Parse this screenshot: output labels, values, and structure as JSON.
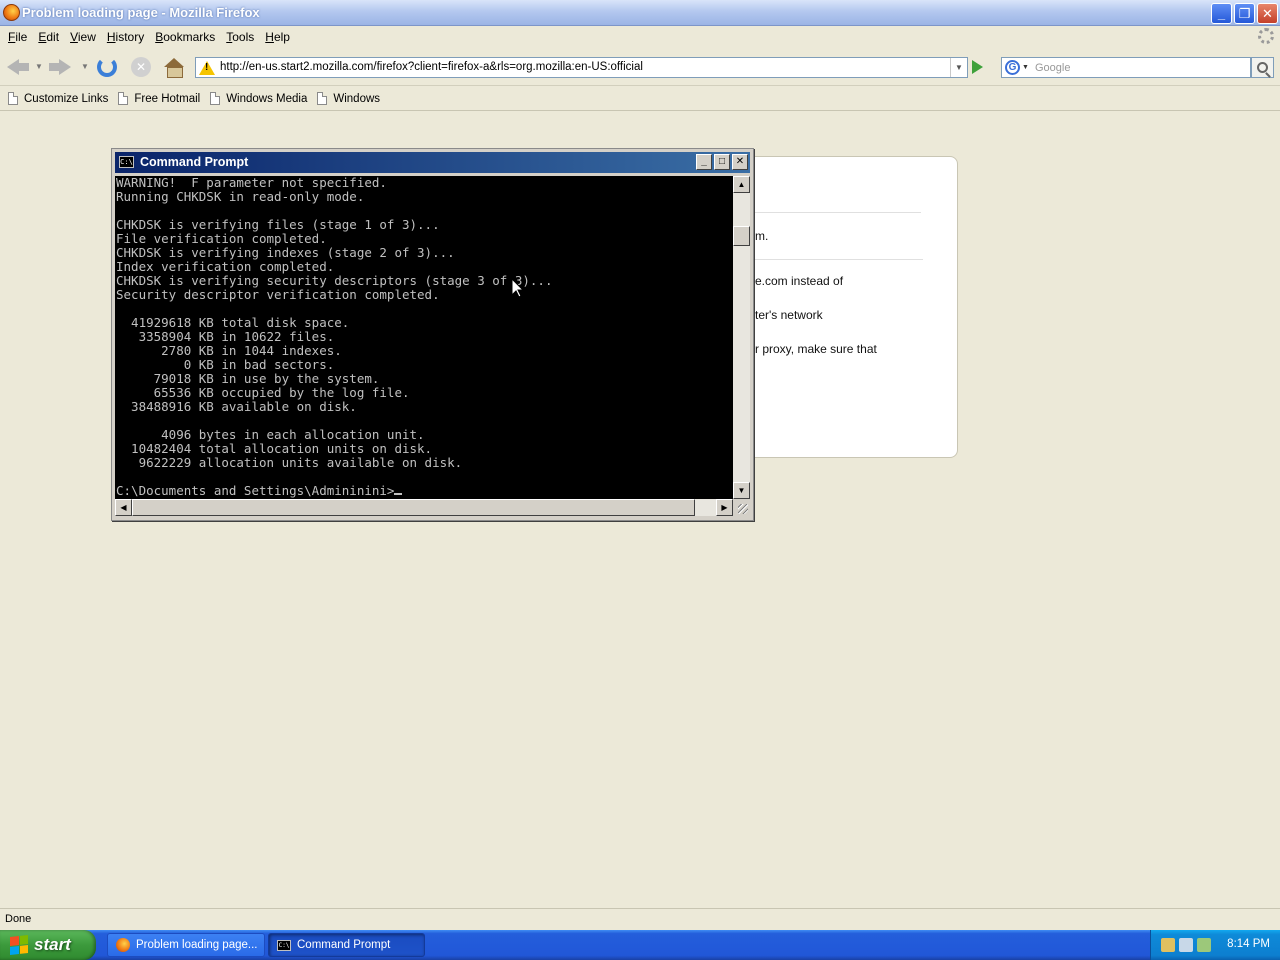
{
  "firefox": {
    "title": "Problem loading page - Mozilla Firefox",
    "menu": [
      "File",
      "Edit",
      "View",
      "History",
      "Bookmarks",
      "Tools",
      "Help"
    ],
    "url": "http://en-us.start2.mozilla.com/firefox?client=firefox-a&rls=org.mozilla:en-US:official",
    "search_placeholder": "Google",
    "bookmarks": [
      "Customize Links",
      "Free Hotmail",
      "Windows Media",
      "Windows"
    ],
    "error_fragments": [
      "m.",
      "e.com instead of",
      "ter's network",
      "r proxy, make sure that"
    ],
    "status": "Done"
  },
  "cmd": {
    "title": "Command Prompt",
    "lines": [
      "WARNING!  F parameter not specified.",
      "Running CHKDSK in read-only mode.",
      "",
      "CHKDSK is verifying files (stage 1 of 3)...",
      "File verification completed.",
      "CHKDSK is verifying indexes (stage 2 of 3)...",
      "Index verification completed.",
      "CHKDSK is verifying security descriptors (stage 3 of 3)...",
      "Security descriptor verification completed.",
      "",
      "  41929618 KB total disk space.",
      "   3358904 KB in 10622 files.",
      "      2780 KB in 1044 indexes.",
      "         0 KB in bad sectors.",
      "     79018 KB in use by the system.",
      "     65536 KB occupied by the log file.",
      "  38488916 KB available on disk.",
      "",
      "      4096 bytes in each allocation unit.",
      "  10482404 total allocation units on disk.",
      "   9622229 allocation units available on disk.",
      ""
    ],
    "prompt": "C:\\Documents and Settings\\Admininini>"
  },
  "taskbar": {
    "start": "start",
    "tasks": [
      "Problem loading page...",
      "Command Prompt"
    ],
    "clock": "8:14 PM"
  }
}
